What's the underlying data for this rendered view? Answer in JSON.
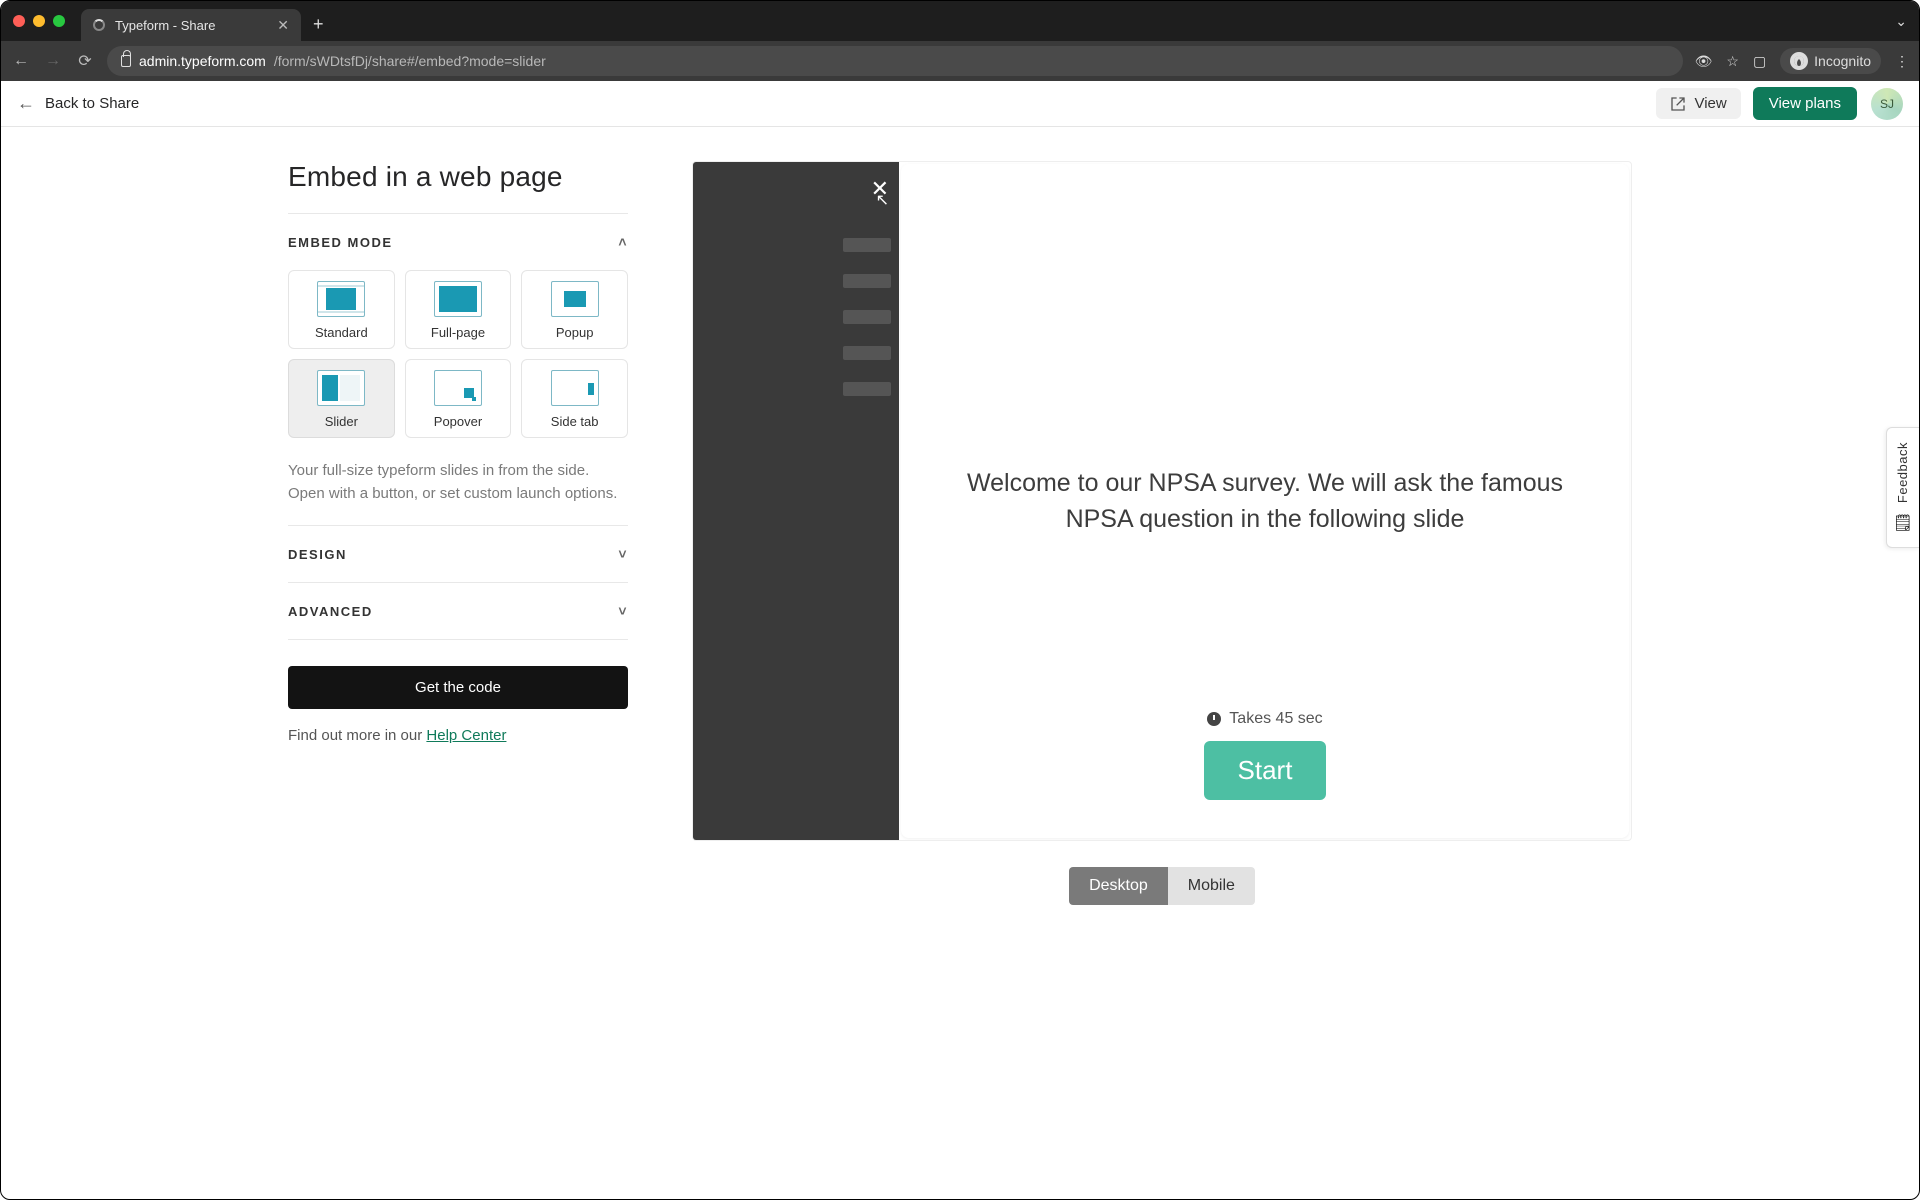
{
  "browser": {
    "tab_title": "Typeform - Share",
    "url_host": "admin.typeform.com",
    "url_path": "/form/sWDtsfDj/share#/embed?mode=slider",
    "incognito_label": "Incognito"
  },
  "appbar": {
    "back_label": "Back to Share",
    "view_label": "View",
    "plans_label": "View plans",
    "avatar_initials": "SJ"
  },
  "left": {
    "page_title": "Embed in a web page",
    "sections": {
      "embed_mode": "EMBED MODE",
      "design": "DESIGN",
      "advanced": "ADVANCED"
    },
    "modes": [
      {
        "id": "standard",
        "label": "Standard",
        "selected": false
      },
      {
        "id": "fullpage",
        "label": "Full-page",
        "selected": false
      },
      {
        "id": "popup",
        "label": "Popup",
        "selected": false
      },
      {
        "id": "slider",
        "label": "Slider",
        "selected": true
      },
      {
        "id": "popover",
        "label": "Popover",
        "selected": false
      },
      {
        "id": "sidetab",
        "label": "Side tab",
        "selected": false
      }
    ],
    "mode_description": "Your full-size typeform slides in from the side. Open with a button, or set custom launch options.",
    "get_code_label": "Get the code",
    "help_prefix": "Find out more in our ",
    "help_link_label": "Help Center"
  },
  "preview": {
    "welcome_text": "Welcome to our NPSA survey. We will ask the famous NPSA question in the following slide",
    "takes_label": "Takes 45 sec",
    "start_label": "Start",
    "device": {
      "desktop": "Desktop",
      "mobile": "Mobile",
      "active": "desktop"
    }
  },
  "feedback": {
    "label": "Feedback"
  }
}
